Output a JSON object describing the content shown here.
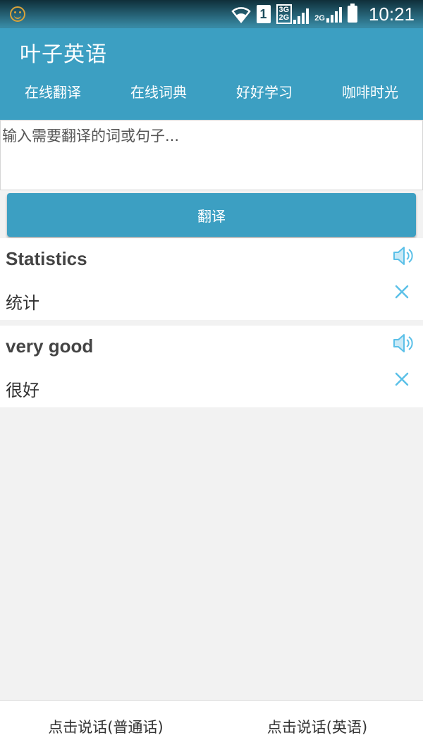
{
  "status_bar": {
    "time": "10:21",
    "sim_slot": "1",
    "network_a_top": "3G",
    "network_a_bottom": "2G",
    "network_b": "2G"
  },
  "app": {
    "title": "叶子英语"
  },
  "tabs": [
    {
      "label": "在线翻译"
    },
    {
      "label": "在线词典"
    },
    {
      "label": "好好学习"
    },
    {
      "label": "咖啡时光"
    }
  ],
  "input": {
    "placeholder": "输入需要翻译的词或句子...",
    "value": ""
  },
  "translate_button": {
    "label": "翻译"
  },
  "results": [
    {
      "source": "Statistics",
      "translation": "统计"
    },
    {
      "source": "very good",
      "translation": "很好"
    }
  ],
  "bottom_bar": {
    "speak_mandarin": "点击说话(普通话)",
    "speak_english": "点击说话(英语)"
  },
  "colors": {
    "primary": "#3c9fc2",
    "icon_accent": "#5bc0e8",
    "background": "#f2f2f2"
  },
  "icons": {
    "speaker": "speaker-icon",
    "close": "close-icon"
  }
}
